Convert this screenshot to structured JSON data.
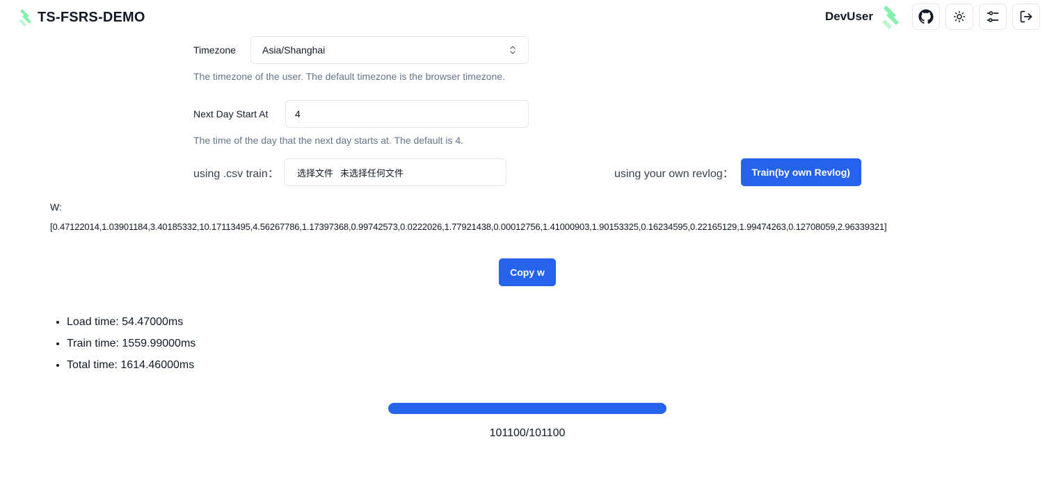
{
  "header": {
    "app_title": "TS-FSRS-DEMO",
    "user_name": "DevUser",
    "icons": [
      "github-icon",
      "sun-icon",
      "sliders-icon",
      "logout-icon"
    ]
  },
  "settings": {
    "timezone_label": "Timezone",
    "timezone_value": "Asia/Shanghai",
    "timezone_help": "The timezone of the user. The default timezone is the browser timezone.",
    "next_day_label": "Next Day Start At",
    "next_day_value": "4",
    "next_day_help": "The time of the day that the next day starts at. The default is 4."
  },
  "train": {
    "csv_label": "using .csv train：",
    "file_button": "选择文件",
    "file_status": "未选择任何文件",
    "revlog_label": "using your own revlog：",
    "revlog_button": "Train(by own Revlog)"
  },
  "weights": {
    "label": "W:",
    "values": "[0.47122014,1.03901184,3.40185332,10.17113495,4.56267786,1.17397368,0.99742573,0.0222026,1.77921438,0.00012756,1.41000903,1.90153325,0.16234595,0.22165129,1.99474263,0.12708059,2.96339321]",
    "copy_button": "Copy w"
  },
  "stats": [
    "Load time: 54.47000ms",
    "Train time: 1559.99000ms",
    "Total time: 1614.46000ms"
  ],
  "progress": {
    "fraction": 1.0,
    "text": "101100/101100"
  },
  "colors": {
    "primary": "#2563eb",
    "logo_green": "#86efac"
  }
}
